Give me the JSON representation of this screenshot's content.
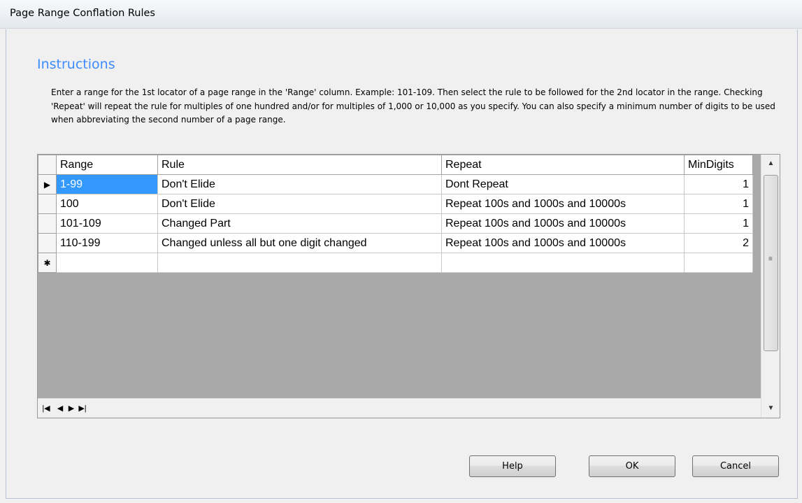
{
  "window": {
    "title": "Page Range Conflation Rules"
  },
  "instructions": {
    "heading": "Instructions",
    "text": "Enter a range for the 1st locator of a page range in the 'Range' column. Example: 101-109. Then select the rule to be followed for the 2nd locator in the range. Checking 'Repeat' will repeat the rule for multiples of one hundred and/or for multiples of 1,000 or 10,000 as you specify. You can also specify a minimum number of digits to be used when abbreviating the second number of a page range."
  },
  "grid": {
    "columns": [
      "Range",
      "Rule",
      "Repeat",
      "MinDigits"
    ],
    "rows": [
      {
        "range": "1-99",
        "rule": "Don't Elide",
        "repeat": "Dont Repeat",
        "min_digits": "1"
      },
      {
        "range": "100",
        "rule": "Don't Elide",
        "repeat": "Repeat 100s and 1000s and 10000s",
        "min_digits": "1"
      },
      {
        "range": "101-109",
        "rule": "Changed Part",
        "repeat": "Repeat 100s and 1000s and 10000s",
        "min_digits": "1"
      },
      {
        "range": "110-199",
        "rule": "Changed unless all but one digit changed",
        "repeat": "Repeat 100s and 1000s and 10000s",
        "min_digits": "2"
      }
    ],
    "selected_row_index": 0,
    "new_row_marker": "✱",
    "current_row_marker": "▶"
  },
  "nav": {
    "first": "|◀",
    "prev": "◀",
    "next": "▶",
    "last": "▶|"
  },
  "scroll": {
    "up": "▲",
    "down": "▼",
    "grip": "≡"
  },
  "buttons": {
    "help": "Help",
    "ok": "OK",
    "cancel": "Cancel"
  },
  "colors": {
    "heading": "#3d8bff",
    "selection": "#3399ff",
    "grid_empty": "#a9a9a9"
  }
}
